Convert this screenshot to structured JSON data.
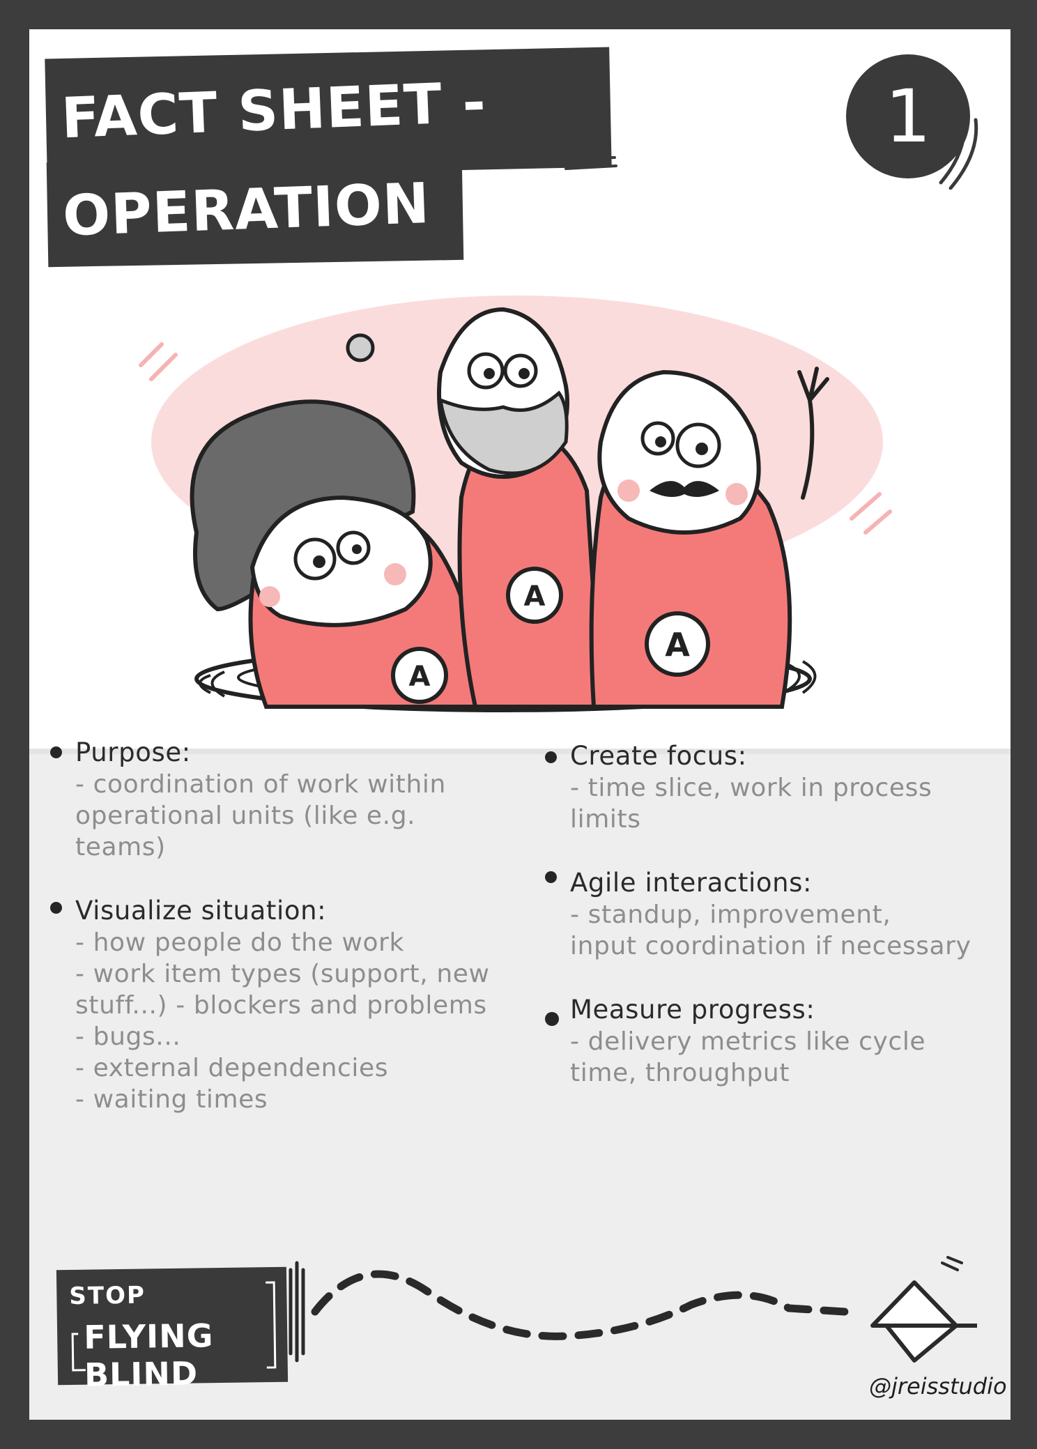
{
  "title": {
    "line1": "FACT SHEET -",
    "line2": "OPERATION"
  },
  "card_number": "1",
  "illustration": {
    "shirt_letters": [
      "A",
      "A",
      "A"
    ],
    "colors": {
      "shirt": "#f47a7a",
      "halo": "#fbdcdc",
      "hair": "#6a6a6a",
      "beard": "#cfcfcf"
    }
  },
  "left_column": [
    {
      "heading": "Purpose:",
      "lines": [
        "- coordination of work within",
        "operational units (like e.g.",
        "teams)"
      ]
    },
    {
      "heading": "Visualize situation:",
      "lines": [
        "- how people do the work",
        "- work item types (support, new",
        "stuff...) - blockers and problems",
        "- bugs...",
        "- external dependencies",
        "- waiting times"
      ]
    }
  ],
  "right_column": [
    {
      "heading": "Create focus:",
      "lines": [
        "- time slice, work in process",
        "limits"
      ]
    },
    {
      "heading": "Agile interactions:",
      "lines": [
        "- standup, improvement,",
        "input coordination if necessary"
      ]
    },
    {
      "heading": "Measure progress:",
      "lines": [
        "- delivery metrics like cycle",
        "time, throughput"
      ]
    }
  ],
  "footer": {
    "stop_line1": "STOP",
    "stop_line2": "FLYING BLIND",
    "credit": "@jreisstudio"
  }
}
